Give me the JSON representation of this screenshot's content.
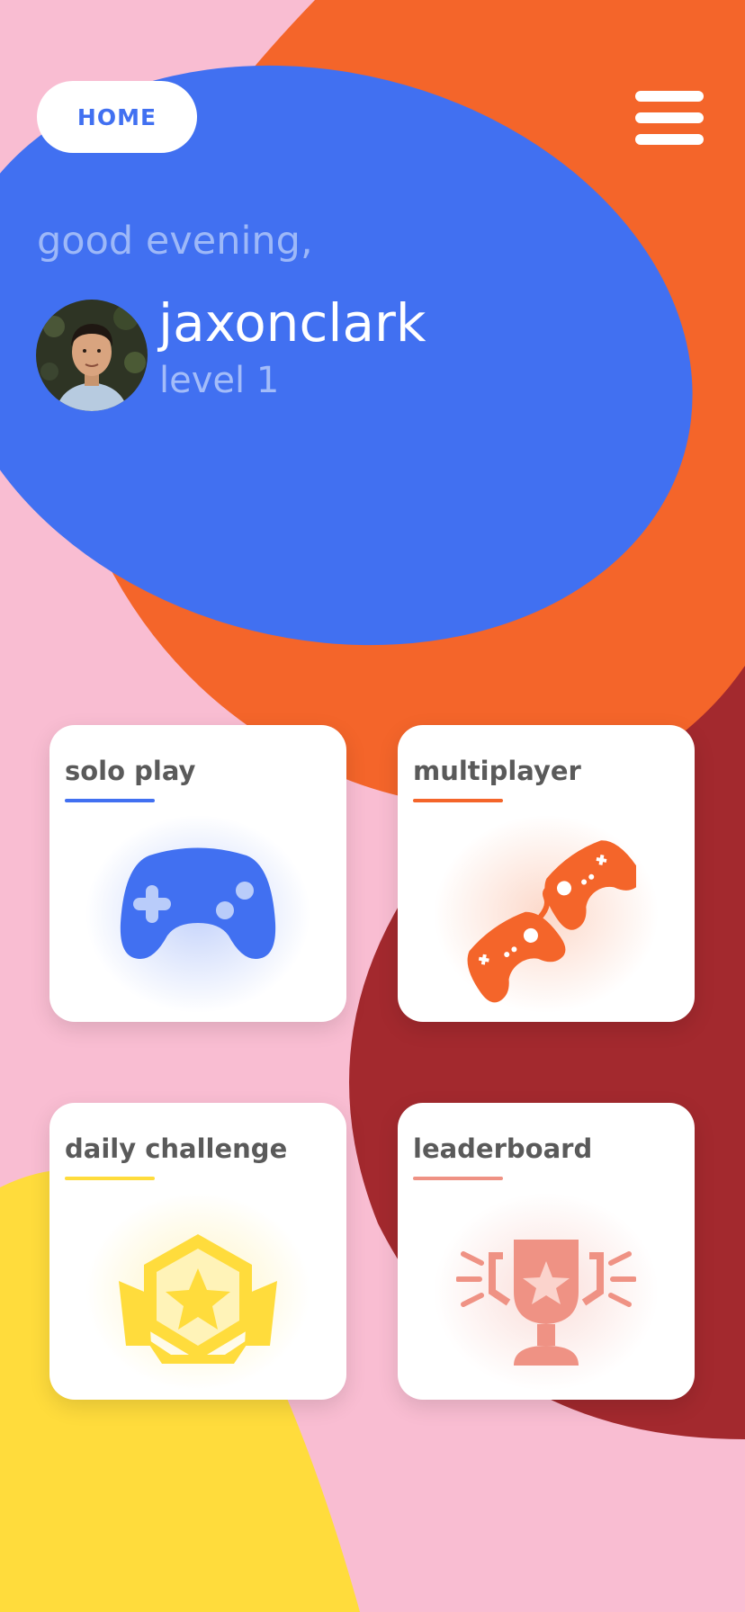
{
  "header": {
    "home_label": "HOME",
    "menu_icon": "hamburger-menu-icon"
  },
  "greeting": {
    "text": "good evening,",
    "username": "jaxonclark",
    "level": "level 1"
  },
  "cards": [
    {
      "title": "solo play",
      "icon": "gamepad-icon",
      "accent": "#4170f1"
    },
    {
      "title": "multiplayer",
      "icon": "linked-controllers-icon",
      "accent": "#f4652a"
    },
    {
      "title": "daily challenge",
      "icon": "star-badge-icon",
      "accent": "#ffdc3c"
    },
    {
      "title": "leaderboard",
      "icon": "trophy-icon",
      "accent": "#ef9284"
    }
  ],
  "colors": {
    "blue": "#4170f1",
    "orange": "#f4652a",
    "dark_red": "#a3292e",
    "pink": "#f9bdd2",
    "yellow": "#ffdc3c"
  }
}
